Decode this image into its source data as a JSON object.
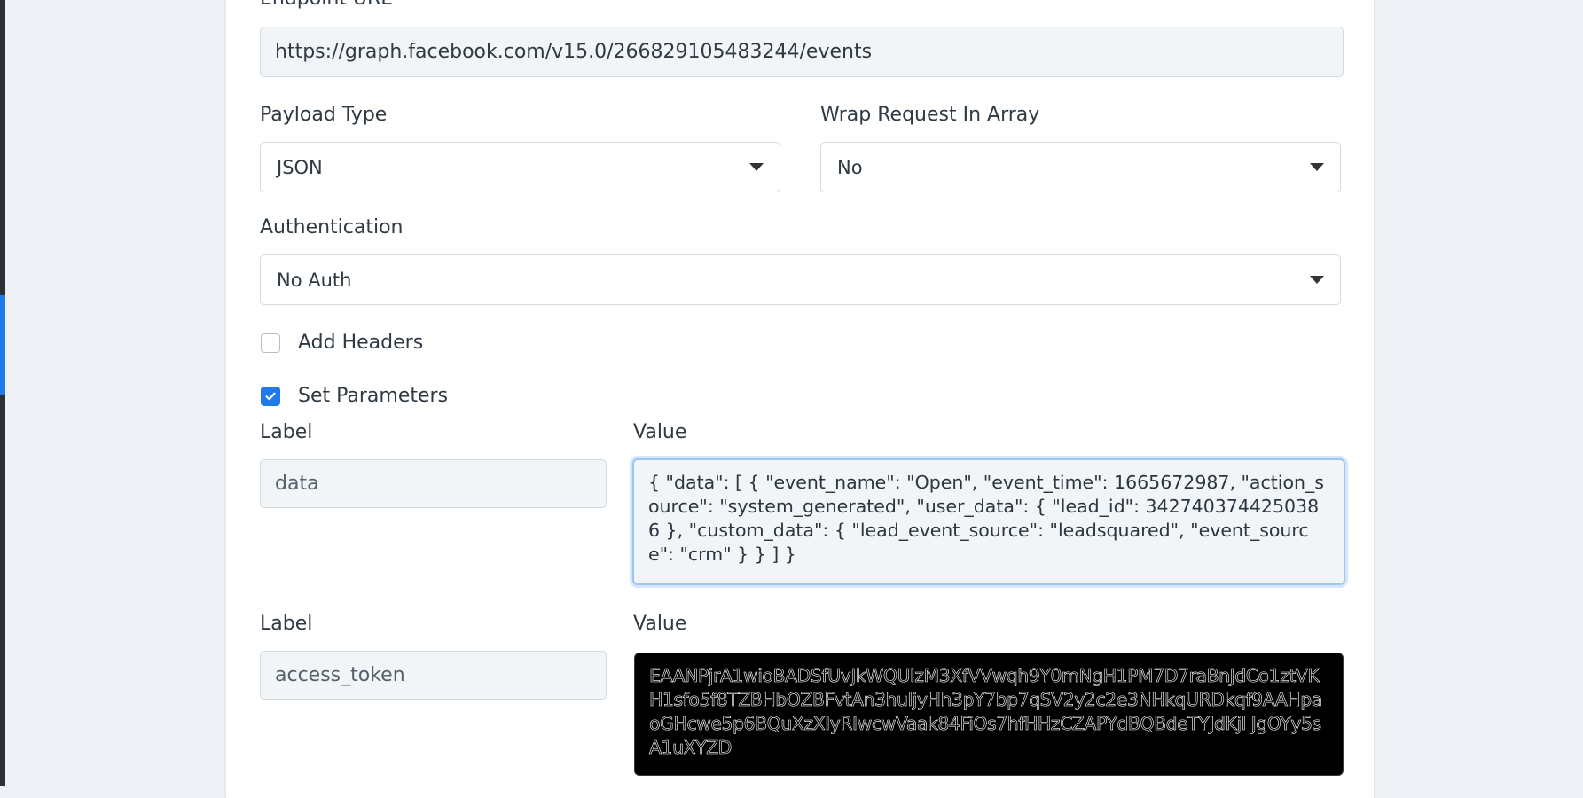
{
  "endpoint": {
    "label": "Endpoint URL",
    "value": "https://graph.facebook.com/v15.0/266829105483244/events"
  },
  "payload_type": {
    "label": "Payload Type",
    "selected": "JSON"
  },
  "wrap_request": {
    "label": "Wrap Request In Array",
    "selected": "No"
  },
  "authentication": {
    "label": "Authentication",
    "selected": "No Auth"
  },
  "add_headers": {
    "label": "Add Headers",
    "checked": false
  },
  "set_parameters": {
    "label": "Set Parameters",
    "checked": true
  },
  "parameters": [
    {
      "label_heading": "Label",
      "value_heading": "Value",
      "label": "data",
      "value": "{ \"data\": [ { \"event_name\": \"Open\", \"event_time\": 1665672987, \"action_source\": \"system_generated\", \"user_data\": { \"lead_id\": 3427403744250386 }, \"custom_data\": { \"lead_event_source\": \"leadsquared\", \"event_source\": \"crm\" } } ] }"
    },
    {
      "label_heading": "Label",
      "value_heading": "Value",
      "label": "access_token",
      "value": "EAANPjrA1wioBADSfUvJkWQUlzM3XfVVwqh9Y0mNgH1PM7D7raBnJdCo1ztVKH1sfo5f8TZBHbOZBFvtAn3huljyHh3pY7bp7qSV2y2c2e3NHkqURDkqf9AAHpaoGHcwe5p6BQuXzXIyRIwcwVaak84FiOs7hfHHzCZAPYdBQBdeTYJdKjl JgOYy5sA1uXYZD"
    }
  ],
  "colors": {
    "accent": "#1f7aea",
    "focus_ring": "#9cc6f3"
  },
  "icons": {
    "caret": "caret-down-icon",
    "check": "check-icon"
  }
}
